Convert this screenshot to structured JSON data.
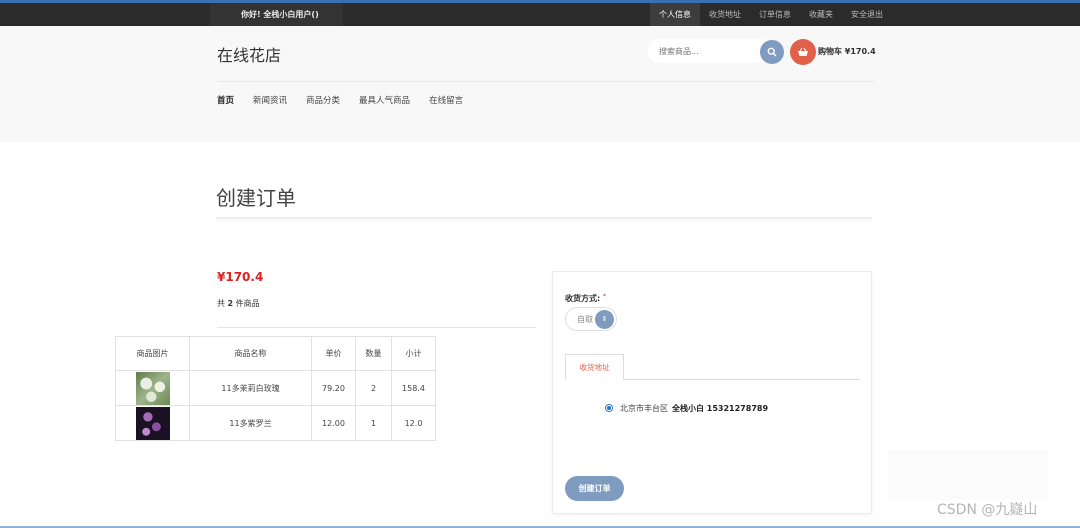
{
  "topbar": {
    "greeting": "你好!  全栈小白用户()",
    "links": [
      "个人信息",
      "收货地址",
      "订单信息",
      "收藏夹",
      "安全退出"
    ]
  },
  "header": {
    "logo": "在线花店",
    "search_placeholder": "搜索商品...",
    "cart_label": "购物车 ¥170.4",
    "nav": [
      "首页",
      "新闻资讯",
      "商品分类",
      "最具人气商品",
      "在线留言"
    ]
  },
  "page": {
    "title": "创建订单",
    "total": "¥170.4",
    "count_prefix": "共",
    "count_value": "2",
    "count_suffix": "件商品"
  },
  "table": {
    "headers": [
      "商品图片",
      "商品名称",
      "单价",
      "数量",
      "小计"
    ],
    "rows": [
      {
        "name": "11多茉莉白玫瑰",
        "price": "79.20",
        "qty": "2",
        "subtotal": "158.4"
      },
      {
        "name": "11多紫罗兰",
        "price": "12.00",
        "qty": "1",
        "subtotal": "12.0"
      }
    ]
  },
  "order_form": {
    "shipping_label": "收货方式:",
    "required_mark": "*",
    "shipping_value": "自取",
    "tab_label": "收货地址",
    "address_text": "北京市丰台区",
    "address_name": "全栈小白 15321278789",
    "submit_label": "创建订单"
  },
  "watermark": "CSDN @九嶷山",
  "colors": {
    "accent_blue": "#7f9bbf",
    "cart_orange": "#e0604a",
    "price_red": "#e02020",
    "topbar": "#2b2b2b"
  }
}
